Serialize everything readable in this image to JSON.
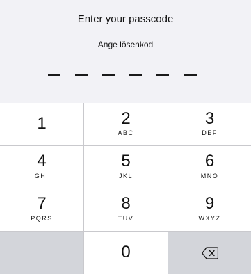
{
  "prompt": {
    "title": "Enter your passcode",
    "subtitle": "Ange lösenkod",
    "entered_count": 0,
    "passcode_length": 6
  },
  "keypad": {
    "keys": [
      {
        "digit": "1",
        "letters": ""
      },
      {
        "digit": "2",
        "letters": "ABC"
      },
      {
        "digit": "3",
        "letters": "DEF"
      },
      {
        "digit": "4",
        "letters": "GHI"
      },
      {
        "digit": "5",
        "letters": "JKL"
      },
      {
        "digit": "6",
        "letters": "MNO"
      },
      {
        "digit": "7",
        "letters": "PQRS"
      },
      {
        "digit": "8",
        "letters": "TUV"
      },
      {
        "digit": "9",
        "letters": "WXYZ"
      },
      {
        "digit": "0",
        "letters": ""
      }
    ],
    "delete_icon": "backspace-icon"
  }
}
